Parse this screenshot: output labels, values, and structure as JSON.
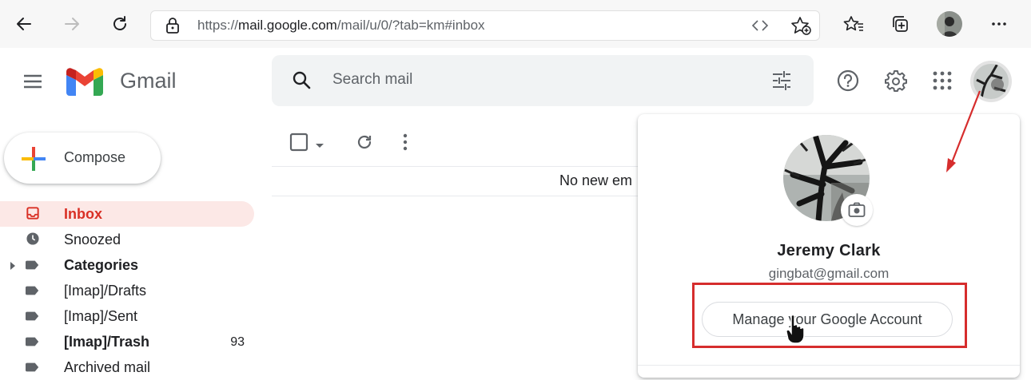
{
  "browser": {
    "url_scheme": "https://",
    "url_host": "mail.google.com",
    "url_path": "/mail/u/0/?tab=km#inbox",
    "icons": [
      "back-arrow-icon",
      "forward-arrow-icon",
      "refresh-icon",
      "lock-icon",
      "reader-mode-icon",
      "add-favorite-icon",
      "favorites-icon",
      "collections-icon",
      "profile-avatar",
      "more-icon"
    ]
  },
  "header": {
    "app_name": "Gmail",
    "search_placeholder": "Search mail"
  },
  "compose": {
    "label": "Compose"
  },
  "sidebar": {
    "items": [
      {
        "label": "Inbox",
        "count": "",
        "active": true
      },
      {
        "label": "Snoozed",
        "count": ""
      },
      {
        "label": "Categories",
        "count": "",
        "bold": true
      },
      {
        "label": "[Imap]/Drafts",
        "count": ""
      },
      {
        "label": "[Imap]/Sent",
        "count": ""
      },
      {
        "label": "[Imap]/Trash",
        "count": "93",
        "bold": true
      },
      {
        "label": "Archived mail",
        "count": ""
      }
    ]
  },
  "main": {
    "empty_text": "No new em"
  },
  "account": {
    "name": "Jeremy Clark",
    "email": "gingbat@gmail.com",
    "manage_label": "Manage your Google Account"
  },
  "colors": {
    "gmail_red": "#d93025",
    "annotation_red": "#d62d2d",
    "inbox_bg": "#fce8e6"
  }
}
